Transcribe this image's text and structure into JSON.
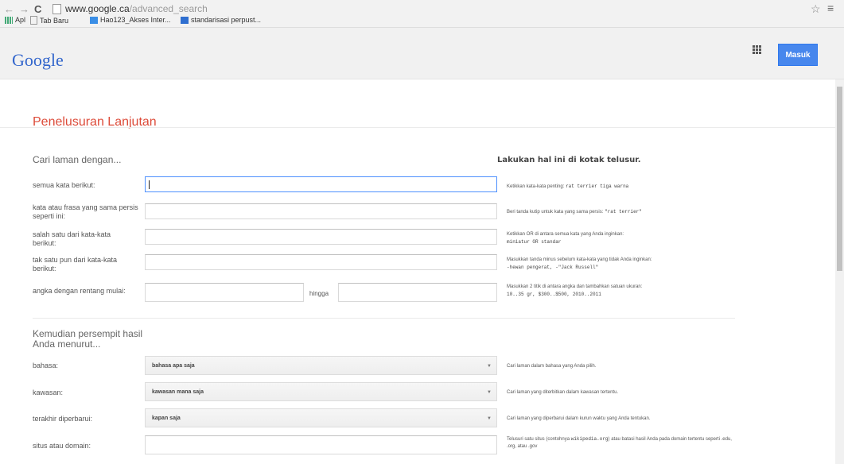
{
  "browser": {
    "url_host": "www.google.ca",
    "url_path": "/advanced_search",
    "bookmarks": [
      "Apl",
      "Tab Baru",
      "Hao123_Akses Inter...",
      "standarisasi perpust..."
    ]
  },
  "header": {
    "logo": "Google",
    "signin_label": "Masuk"
  },
  "page_title": "Penelusuran Lanjutan",
  "find": {
    "heading": "Cari laman dengan...",
    "hint_heading": "Lakukan hal ini di kotak telusur.",
    "rows": [
      {
        "label": "semua kata berikut:",
        "value": "",
        "hint": "Ketikkan kata-kata penting:",
        "hint_code": "rat terrier tiga warna",
        "hint2": "",
        "hint_code2": ""
      },
      {
        "label": "kata atau frasa yang sama persis seperti ini:",
        "value": "",
        "hint": "Beri tanda kutip untuk kata yang sama persis:",
        "hint_code": "\"rat terrier\"",
        "hint2": "",
        "hint_code2": ""
      },
      {
        "label": "salah satu dari kata-kata berikut:",
        "value": "",
        "hint": "Ketikkan OR di antara semua kata yang Anda inginkan:",
        "hint_code": "miniatur OR standar",
        "hint2": "",
        "hint_code2": ""
      },
      {
        "label": "tak satu pun dari kata-kata berikut:",
        "value": "",
        "hint": "Masukkan tanda minus sebelum kata-kata yang tidak Anda inginkan:",
        "hint_code": "-hewan pengerat, -\"Jack Russell\"",
        "hint2": "",
        "hint_code2": ""
      },
      {
        "label": "angka dengan rentang mulai:",
        "value": "",
        "to_label": "hingga",
        "hint": "Masukkan 2 titik di antara angka dan tambahkan satuan ukuran:",
        "hint_code": "10..35 gr, $300..$500, 2010..2011",
        "hint2": "",
        "hint_code2": ""
      }
    ]
  },
  "narrow": {
    "heading": "Kemudian persempit hasil Anda menurut...",
    "rows": [
      {
        "label": "bahasa:",
        "value": "bahasa apa saja",
        "hint": "Cari laman dalam bahasa yang Anda pilih."
      },
      {
        "label": "kawasan:",
        "value": "kawasan mana saja",
        "hint": "Cari laman yang diterbitkan dalam kawasan tertentu."
      },
      {
        "label": "terakhir diperbarui:",
        "value": "kapan saja",
        "hint": "Cari laman yang diperbarui dalam kurun waktu yang Anda tentukan."
      },
      {
        "label": "situs atau domain:",
        "value": "",
        "hint": "Telusuri satu situs (contohnya",
        "hint_code": "wikipedia.org",
        "hint_tail": ") atau batasi hasil Anda pada domain tertentu seperti .edu, .org, atau .gov"
      }
    ]
  },
  "colors": {
    "accent_red": "#dd4b39",
    "button_blue": "#4787ed",
    "logo_blue": "#3366cc"
  },
  "icons": [
    "back-arrow-icon",
    "forward-arrow-icon",
    "reload-icon",
    "page-icon",
    "star-icon",
    "menu-icon",
    "apps-grid-icon"
  ]
}
